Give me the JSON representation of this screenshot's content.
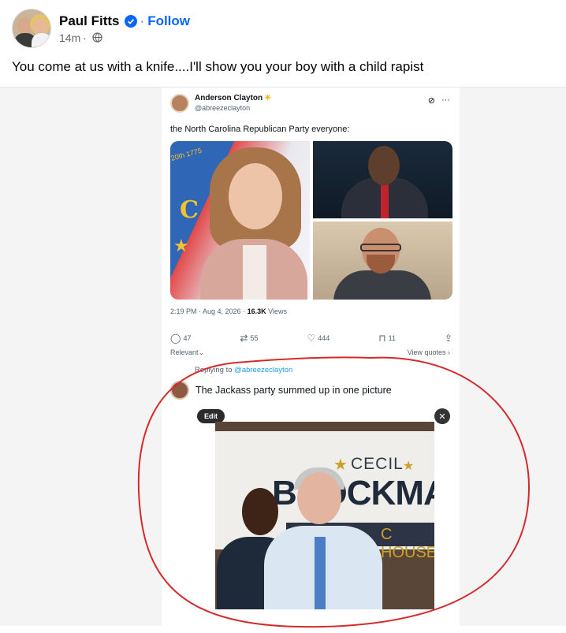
{
  "post": {
    "author_name": "Paul Fitts",
    "follow_label": "Follow",
    "time": "14m",
    "separator": "·",
    "caption": "You come at us with a knife....I'll show you your boy with a child rapist"
  },
  "tweet": {
    "name": "Anderson Clayton",
    "name_emoji": "☀",
    "handle": "@abreezeclayton",
    "text": "the North Carolina Republican Party everyone:",
    "time": "2:19 PM · Aug 4, 2026 · ",
    "views_count": "16.3K",
    "views_label": " Views",
    "actions": {
      "replies": "47",
      "reposts": "55",
      "likes": "444",
      "bookmarks": "11"
    },
    "relevant_label": "Relevant",
    "view_quotes_label": "View quotes",
    "image_text": {
      "seal": "20th 1775",
      "state": "C"
    }
  },
  "reply": {
    "replying_prefix": "Replying to ",
    "replying_handle": "@abreezeclayton",
    "text": "The Jackass party summed up in one picture",
    "edit_label": "Edit",
    "close_label": "✕",
    "banner_line1": "CECIL",
    "banner_line2": "BROCKMA",
    "banner_line3": "C HOUSE"
  },
  "colors": {
    "follow": "#0866ff",
    "tweet_link": "#1d9bf0",
    "annotation_circle": "#d62a2a"
  }
}
